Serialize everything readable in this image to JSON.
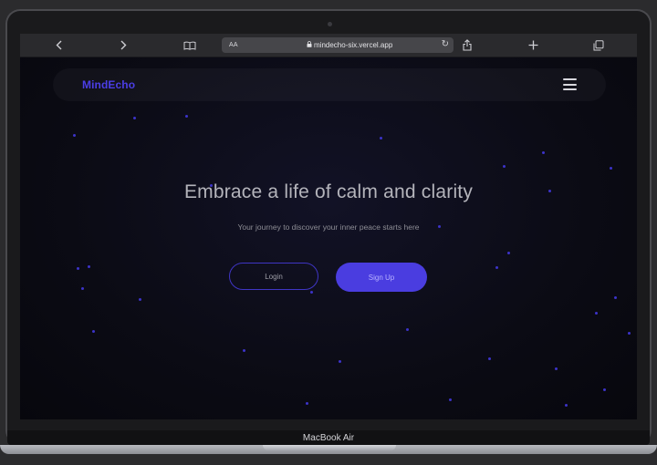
{
  "browser": {
    "aa_label": "AA",
    "url": "mindecho-six.vercel.app",
    "icons": [
      "back-icon",
      "forward-icon",
      "book-icon",
      "lock-icon",
      "reload-icon",
      "share-icon",
      "plus-icon",
      "tabs-icon"
    ]
  },
  "site": {
    "brand": "MindEcho",
    "hero_title": "Embrace a life of calm and clarity",
    "hero_subtitle": "Your journey to discover your inner peace starts here",
    "login_label": "Login",
    "signup_label": "Sign Up"
  },
  "device": {
    "model_label": "MacBook Air"
  },
  "colors": {
    "brand": "#4b3ee6",
    "primary_button": "#4a3de0",
    "background": "#0a0a12"
  }
}
